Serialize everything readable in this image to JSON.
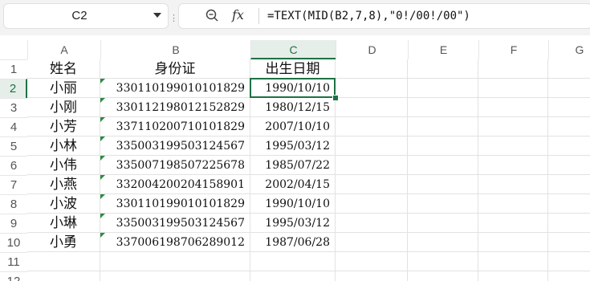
{
  "name_box": {
    "value": "C2"
  },
  "formula_bar": {
    "fx_label": "fx",
    "formula": "=TEXT(MID(B2,7,8),\"0!/00!/00\")"
  },
  "columns": [
    "A",
    "B",
    "C",
    "D",
    "E",
    "F",
    "G"
  ],
  "active_column": "C",
  "rows": [
    "1",
    "2",
    "3",
    "4",
    "5",
    "6",
    "7",
    "8",
    "9",
    "10",
    "11",
    "12"
  ],
  "active_row": "2",
  "active_cell": "C2",
  "table": {
    "headers": [
      "姓名",
      "身份证",
      "出生日期"
    ],
    "records": [
      [
        "小丽",
        "330110199010101829",
        "1990/10/10"
      ],
      [
        "小刚",
        "330112198012152829",
        "1980/12/15"
      ],
      [
        "小芳",
        "337110200710101829",
        "2007/10/10"
      ],
      [
        "小林",
        "335003199503124567",
        "1995/03/12"
      ],
      [
        "小伟",
        "335007198507225678",
        "1985/07/22"
      ],
      [
        "小燕",
        "332004200204158901",
        "2002/04/15"
      ],
      [
        "小波",
        "330110199010101829",
        "1990/10/10"
      ],
      [
        "小琳",
        "335003199503124567",
        "1995/03/12"
      ],
      [
        "小勇",
        "337006198706289012",
        "1987/06/28"
      ]
    ]
  },
  "accent_color": "#1e7145",
  "text_marker_color": "#2f8a45"
}
